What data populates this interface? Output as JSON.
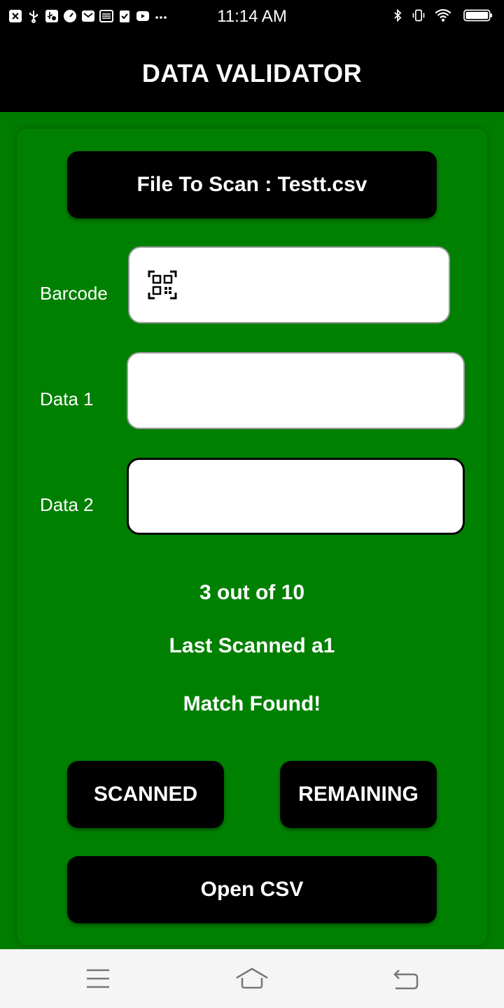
{
  "status_bar": {
    "time": "11:14 AM",
    "left_icons": [
      "close-box-icon",
      "usb-icon",
      "usb-debug-icon",
      "speedometer-icon",
      "mail-icon",
      "inbox-icon",
      "clipboard-check-icon",
      "youtube-icon",
      "more-dots-icon"
    ],
    "right_icons": [
      "bluetooth-icon",
      "vibrate-icon",
      "wifi-icon",
      "battery-icon"
    ]
  },
  "app_bar": {
    "title": "DATA VALIDATOR"
  },
  "file_button": {
    "label": "File To Scan : Testt.csv"
  },
  "fields": {
    "barcode": {
      "label": "Barcode",
      "value": ""
    },
    "data1": {
      "label": "Data 1",
      "value": ""
    },
    "data2": {
      "label": "Data 2",
      "value": ""
    }
  },
  "progress_text": "3 out of 10",
  "last_scanned": "Last Scanned a1",
  "match_status": "Match Found!",
  "buttons": {
    "scanned": "SCANNED",
    "remaining": "REMAINING",
    "open_csv": "Open CSV"
  },
  "nav_bar": {
    "icons": [
      "menu-icon",
      "home-icon",
      "back-icon"
    ]
  },
  "colors": {
    "background": "#007c00",
    "card": "#008000",
    "bar": "#000000",
    "text": "#ffffff"
  }
}
